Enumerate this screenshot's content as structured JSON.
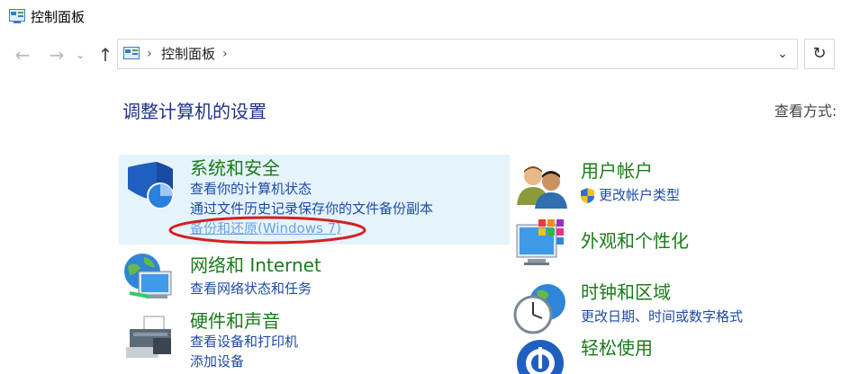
{
  "window": {
    "title": "控制面板"
  },
  "nav": {
    "back_glyph": "←",
    "forward_glyph": "→",
    "recent_glyph": "⌄",
    "up_glyph": "↑",
    "refresh_glyph": "↻",
    "dropdown_glyph": "⌄"
  },
  "address": {
    "separator": "›",
    "crumb": "控制面板",
    "trailing_separator": "›"
  },
  "page": {
    "heading": "调整计算机的设置",
    "view_by_label": "查看方式:"
  },
  "categories": {
    "system_security": {
      "title": "系统和安全",
      "links": [
        "查看你的计算机状态",
        "通过文件历史记录保存你的文件备份副本",
        "备份和还原(Windows 7)"
      ],
      "icon": "security-shield-icon"
    },
    "network": {
      "title": "网络和 Internet",
      "links": [
        "查看网络状态和任务"
      ],
      "icon": "network-globe-icon"
    },
    "hardware": {
      "title": "硬件和声音",
      "links": [
        "查看设备和打印机",
        "添加设备"
      ],
      "icon": "printer-icon"
    },
    "user_accounts": {
      "title": "用户帐户",
      "links": [
        "更改帐户类型"
      ],
      "icon": "users-icon"
    },
    "appearance": {
      "title": "外观和个性化",
      "icon": "monitor-palette-icon"
    },
    "clock_region": {
      "title": "时钟和区域",
      "links": [
        "更改日期、时间或数字格式"
      ],
      "icon": "clock-globe-icon"
    },
    "ease_of_access": {
      "title": "轻松使用",
      "icon": "accessibility-icon"
    }
  },
  "colors": {
    "category_title": "#1a7b1a",
    "link": "#1e4aa8",
    "heading": "#1e3287",
    "highlight_bg": "#e5f3fb",
    "annotation": "#d42020"
  }
}
